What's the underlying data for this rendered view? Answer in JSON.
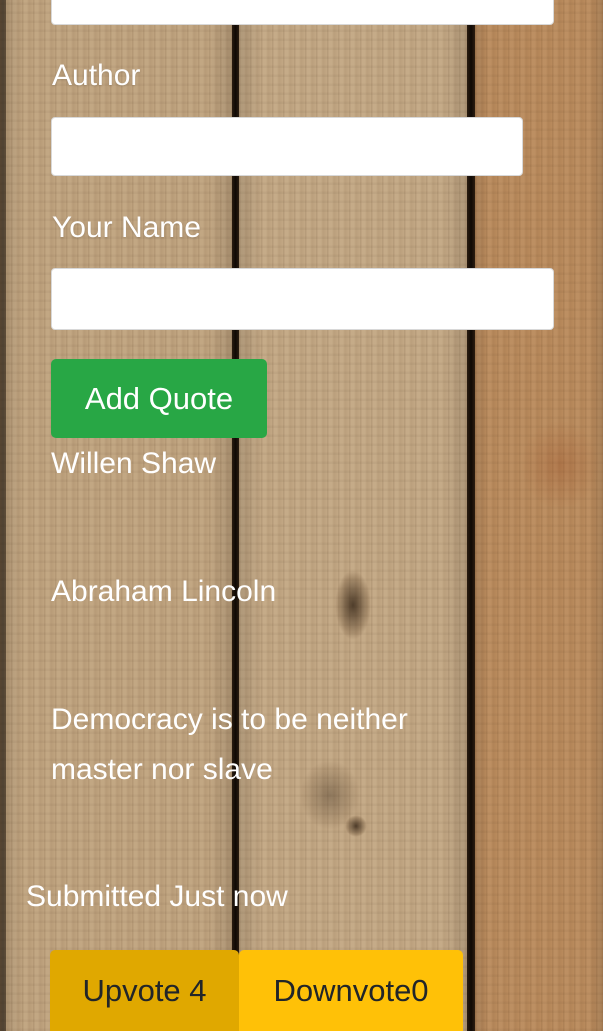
{
  "form": {
    "author_label": "Author",
    "author_value": "",
    "name_label": "Your Name",
    "name_value": "",
    "quote_value": "",
    "add_button": "Add Quote"
  },
  "quote": {
    "submitter": "Willen Shaw",
    "author": "Abraham Lincoln",
    "text_line1": "Democracy is to be neither",
    "text_line2": "master nor slave",
    "submitted": "Submitted Just now",
    "upvote_label": "Upvote 4",
    "downvote_label": "Downvote0"
  },
  "colors": {
    "add_button": "#28a745",
    "upvote_button": "#e0a800",
    "downvote_button": "#ffc107"
  }
}
